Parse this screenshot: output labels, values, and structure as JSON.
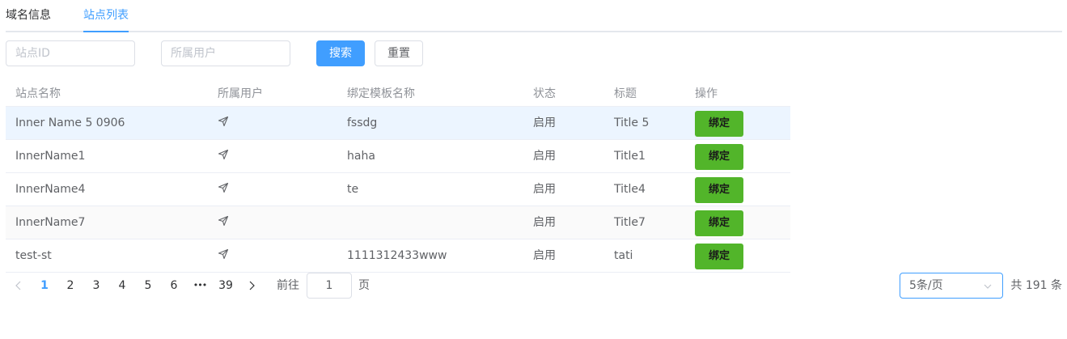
{
  "tabs": [
    {
      "label": "域名信息",
      "active": false
    },
    {
      "label": "站点列表",
      "active": true
    }
  ],
  "filters": {
    "site_id_placeholder": "站点ID",
    "user_placeholder": "所属用户",
    "search_label": "搜索",
    "reset_label": "重置"
  },
  "table": {
    "headers": [
      "站点名称",
      "所属用户",
      "绑定模板名称",
      "状态",
      "标题",
      "操作"
    ],
    "rows": [
      {
        "name": "Inner Name 5 0906",
        "user_icon": "navigation-arrow-icon",
        "template": "fssdg",
        "status": "启用",
        "title": "Title 5",
        "action": "绑定"
      },
      {
        "name": "InnerName1",
        "user_icon": "navigation-arrow-icon",
        "template": "haha",
        "status": "启用",
        "title": "Title1",
        "action": "绑定"
      },
      {
        "name": "InnerName4",
        "user_icon": "navigation-arrow-icon",
        "template": "te",
        "status": "启用",
        "title": "Title4",
        "action": "绑定"
      },
      {
        "name": "InnerName7",
        "user_icon": "navigation-arrow-icon",
        "template": "",
        "status": "启用",
        "title": "Title7",
        "action": "绑定"
      },
      {
        "name": "test-st",
        "user_icon": "navigation-arrow-icon",
        "template": "1111312433www",
        "status": "启用",
        "title": "tati",
        "action": "绑定"
      }
    ]
  },
  "pagination": {
    "prev_icon": "chevron-left-icon",
    "pages": [
      "1",
      "2",
      "3",
      "4",
      "5",
      "6"
    ],
    "active_page": "1",
    "ellipsis": "•••",
    "last_page": "39",
    "next_icon": "chevron-right-icon",
    "goto_prefix": "前往",
    "goto_value": "1",
    "goto_suffix": "页",
    "page_size": "5条/页",
    "total": "共 191 条"
  },
  "colors": {
    "accent": "#409eff",
    "bind_button": "#52b52a",
    "highlight_row": "#ecf5ff"
  }
}
